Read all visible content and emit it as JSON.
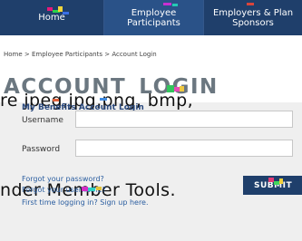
{
  "nav": {
    "items": [
      {
        "label": "Home"
      },
      {
        "label": "Employee Participants"
      },
      {
        "label": "Employers & Plan Sponsors"
      }
    ]
  },
  "breadcrumb": "Home > Employee Participants > Account Login",
  "page_title": {
    "part1": "ACCOUNT",
    "part2": "LOGIN"
  },
  "overlay_lines": [
    "re jpeg,jpg,png, bmp,",
    "nder Member Tools."
  ],
  "login": {
    "section_title": "My Benefits Account Login",
    "username_label": "Username",
    "password_label": "Password",
    "username_value": "",
    "password_value": ""
  },
  "links": {
    "forgot_password": "Forgot your password?",
    "forgot_username": "Forgot your username?",
    "first_time": "First time logging in? Sign up here."
  },
  "submit_label": "SUBMIT",
  "colors": {
    "nav_bg": "#1f3f6b",
    "nav_active": "#2a5288",
    "panel_bg": "#efefef",
    "link": "#2b5ea0",
    "title_gray": "#6b7780"
  }
}
